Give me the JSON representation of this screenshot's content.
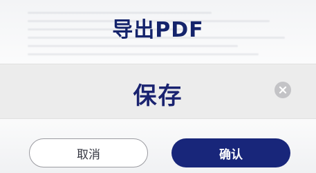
{
  "dialog": {
    "title": "导出PDF",
    "filename_value": "保存",
    "cancel_label": "取消",
    "confirm_label": "确认"
  },
  "icons": {
    "clear": "clear-circle-icon"
  },
  "colors": {
    "accent": "#18267a",
    "title": "#14236b",
    "input_band": "#ececec",
    "clear_icon_bg": "#c3c3c6"
  }
}
